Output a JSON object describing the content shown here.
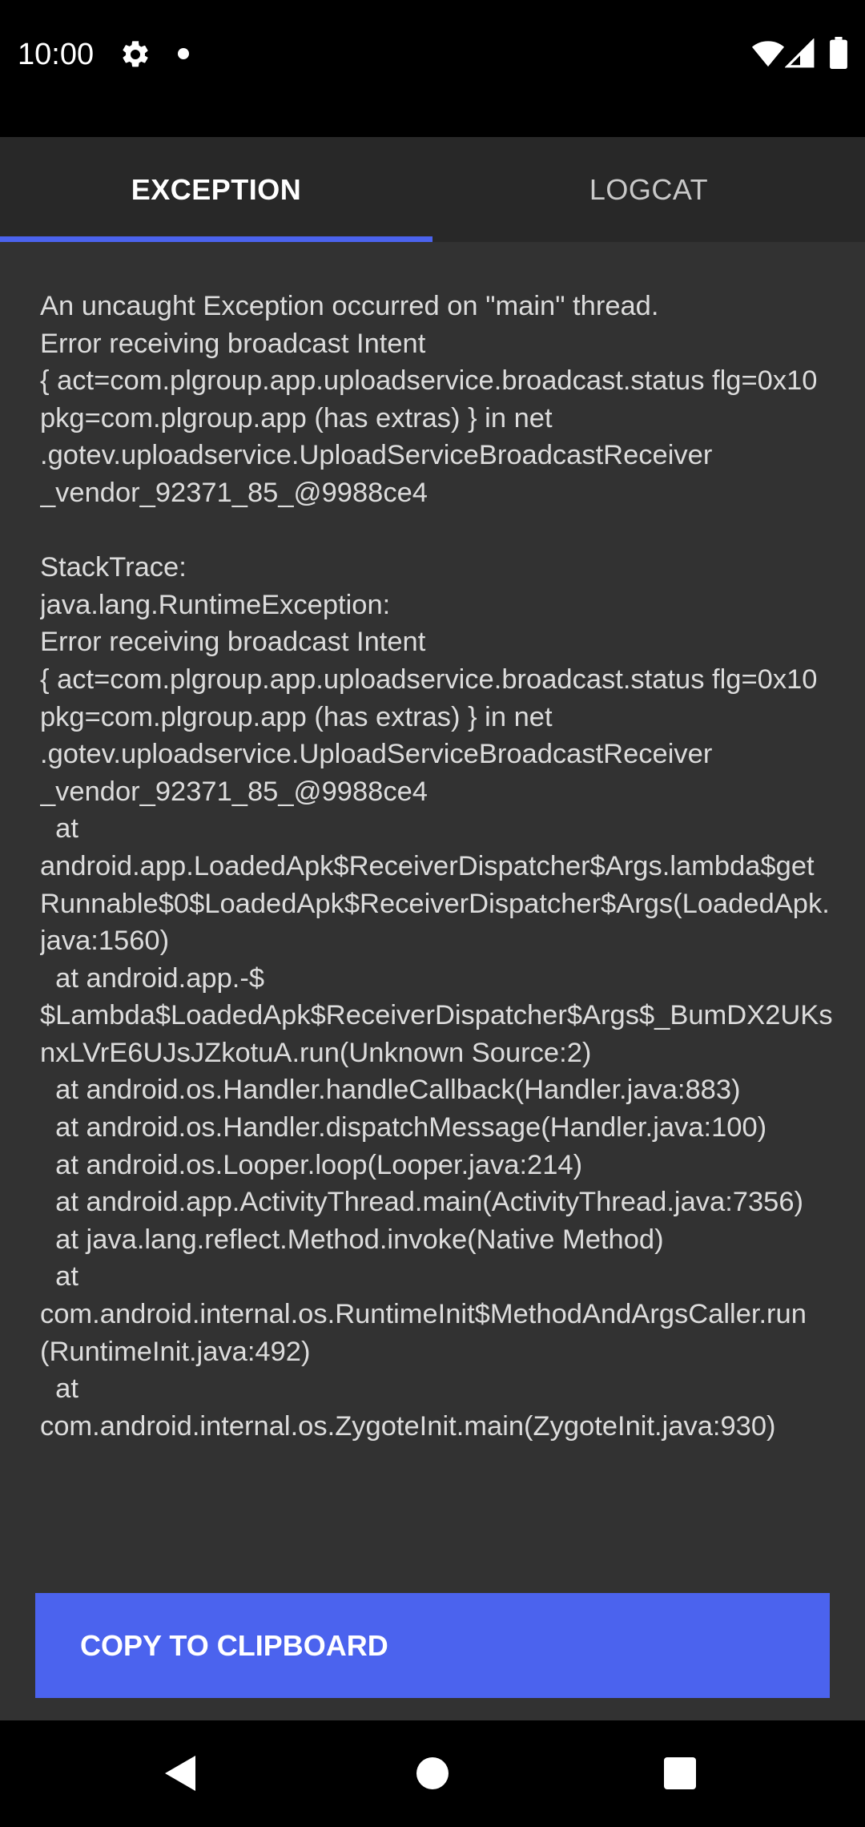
{
  "status_bar": {
    "time": "10:00",
    "icons": [
      "gear-icon",
      "notification-dot-icon",
      "wifi-icon",
      "cell-signal-icon",
      "battery-icon"
    ]
  },
  "tabs": [
    {
      "label": "EXCEPTION",
      "selected": true
    },
    {
      "label": "LOGCAT",
      "selected": false
    }
  ],
  "exception": {
    "message": "An uncaught Exception occurred on \"main\" thread.\nError receiving broadcast Intent\n{ act=com.plgroup.app.uploadservice.broadcast.status flg=0x10 pkg=com.plgroup.app (has extras) } in net\n.gotev.uploadservice.UploadServiceBroadcastReceiver\n_vendor_92371_85_@9988ce4\n\nStackTrace:\njava.lang.RuntimeException:\nError receiving broadcast Intent\n{ act=com.plgroup.app.uploadservice.broadcast.status flg=0x10 pkg=com.plgroup.app (has extras) } in net\n.gotev.uploadservice.UploadServiceBroadcastReceiver\n_vendor_92371_85_@9988ce4\n  at\nandroid.app.LoadedApk$ReceiverDispatcher$Args.lambda$getRunnable$0$LoadedApk$ReceiverDispatcher$Args(LoadedApk.java:1560)\n  at android.app.-$\n$Lambda$LoadedApk$ReceiverDispatcher$Args$_BumDX2UKsnxLVrE6UJsJZkotuA.run(Unknown Source:2)\n  at android.os.Handler.handleCallback(Handler.java:883)\n  at android.os.Handler.dispatchMessage(Handler.java:100)\n  at android.os.Looper.loop(Looper.java:214)\n  at android.app.ActivityThread.main(ActivityThread.java:7356)\n  at java.lang.reflect.Method.invoke(Native Method)\n  at\ncom.android.internal.os.RuntimeInit$MethodAndArgsCaller.run(RuntimeInit.java:492)\n  at\ncom.android.internal.os.ZygoteInit.main(ZygoteInit.java:930)"
  },
  "copy_button": {
    "label": "COPY TO CLIPBOARD"
  },
  "nav_bar": {
    "icons": [
      "back-icon",
      "home-icon",
      "recents-icon"
    ]
  },
  "colors": {
    "accent": "#4b63ee",
    "background": "#323232",
    "tab_bar": "#282828",
    "text": "#dcdcdc"
  }
}
